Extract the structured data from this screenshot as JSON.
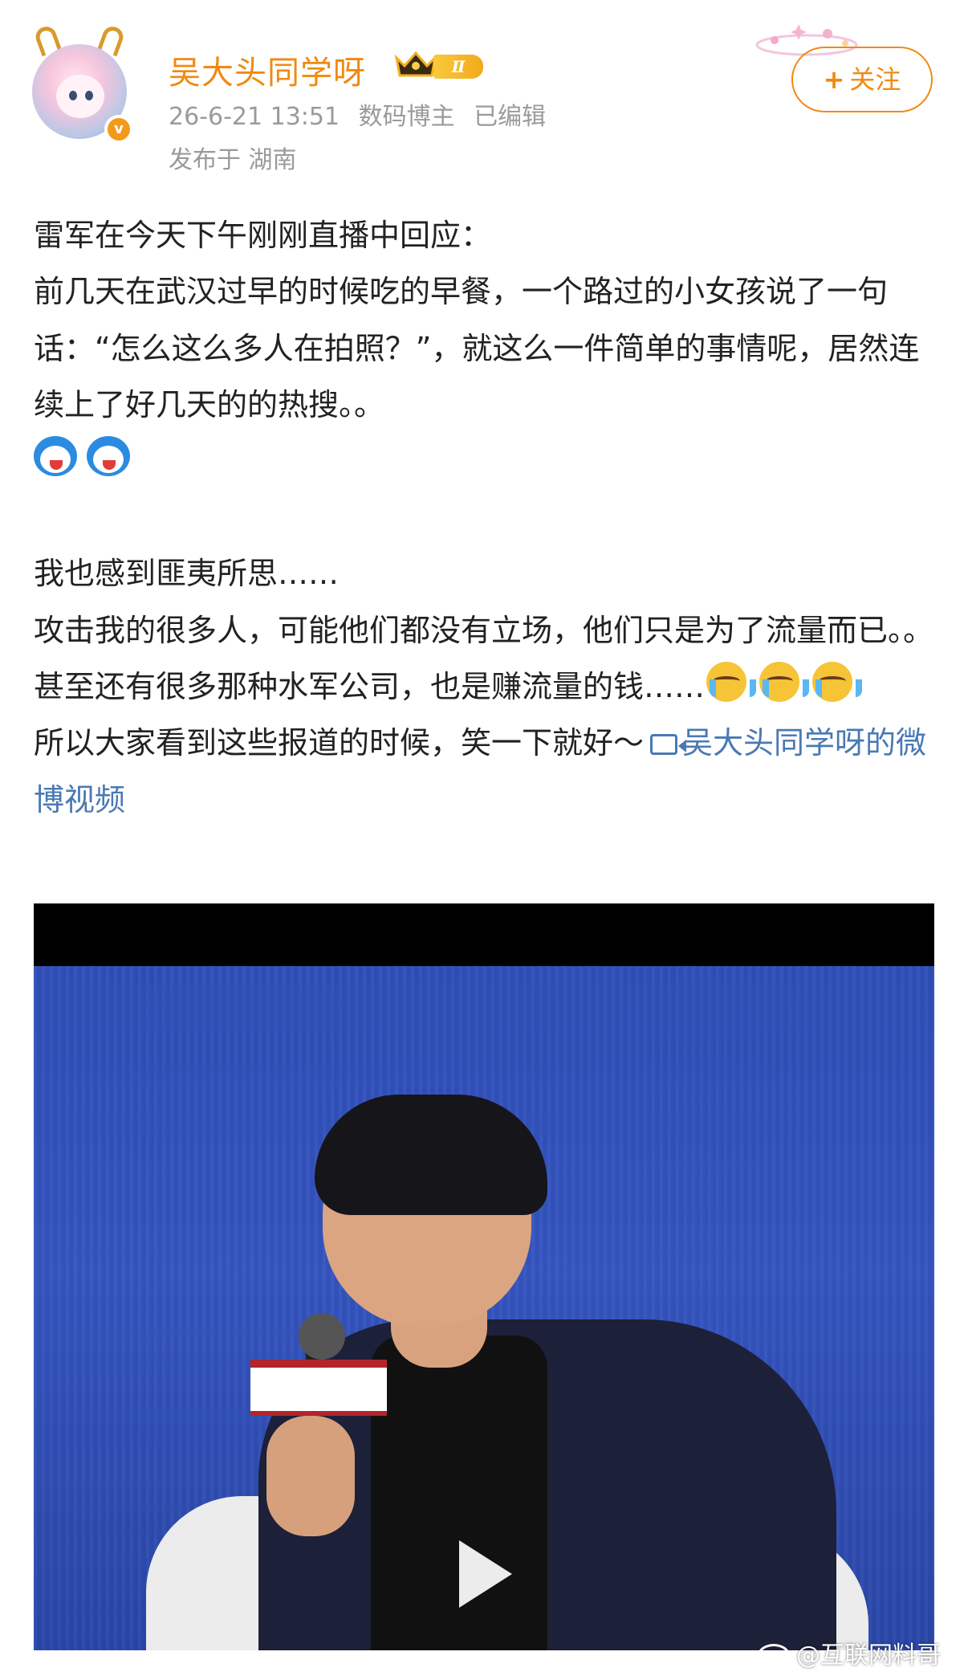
{
  "post": {
    "author": {
      "name": "吴大头同学呀",
      "level_badge": "Ⅱ",
      "verified_badge": "v"
    },
    "meta": {
      "time": "26-6-21 13:51",
      "category": "数码博主",
      "edited": "已编辑",
      "location": "发布于 湖南"
    },
    "follow_button": {
      "plus": "+",
      "label": "关注"
    },
    "body": {
      "p1": "雷军在今天下午刚刚直播中回应：",
      "p2": "前几天在武汉过早的时候吃的早餐，一个路过的小女孩说了一句话：“怎么这么多人在拍照？”，就这么一件简单的事情呢，居然连续上了好几天的的热搜。。",
      "p3": "我也感到匪夷所思……",
      "p4": "攻击我的很多人，可能他们都没有立场，他们只是为了流量而已。。甚至还有很多那种水军公司，也是赚流量的钱……",
      "p5": "所以大家看到这些报道的时候，笑一下就好～",
      "video_link": "吴大头同学呀的微博视频"
    },
    "emoji": {
      "dora": "doraemon-emoji",
      "cry": "crying-face-emoji"
    },
    "video": {
      "play_icon": "play-icon"
    },
    "watermark": "@互联网料哥"
  },
  "colors": {
    "username": "#f08a12",
    "meta": "#9a9a9a",
    "link": "#4a79b3",
    "video_bg": "#3051b9"
  }
}
